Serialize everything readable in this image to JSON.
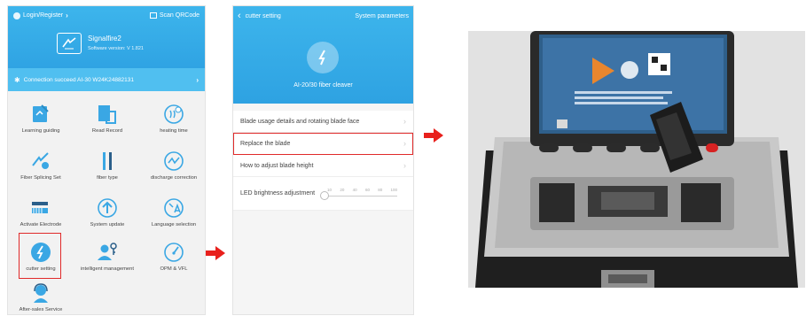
{
  "phone1": {
    "login_label": "Login/Register",
    "scan_label": "Scan QRCode",
    "device_name": "Signalfire2",
    "software_version": "Software version: V 1.821",
    "connection_text": "Connection succeed AI-30 W24K24882131",
    "menu": [
      {
        "label": "Learning guiding",
        "icon": "book-edit-icon"
      },
      {
        "label": "Read Record",
        "icon": "document-icon"
      },
      {
        "label": "heating time",
        "icon": "heat-clock-icon"
      },
      {
        "label": "Fiber Splicing Set",
        "icon": "splice-settings-icon"
      },
      {
        "label": "fiber type",
        "icon": "fiber-type-icon"
      },
      {
        "label": "discharge correction",
        "icon": "discharge-icon"
      },
      {
        "label": "Activate Electrode",
        "icon": "electrode-icon"
      },
      {
        "label": "System update",
        "icon": "upload-icon"
      },
      {
        "label": "Language selection",
        "icon": "language-icon"
      },
      {
        "label": "cutter setting",
        "icon": "cutter-icon"
      },
      {
        "label": "intelligent management",
        "icon": "user-key-icon"
      },
      {
        "label": "OPM & VFL",
        "icon": "gauge-icon"
      },
      {
        "label": "After-sales Service",
        "icon": "support-agent-icon"
      }
    ]
  },
  "phone2": {
    "back_label": "cutter setting",
    "system_parameters_label": "System parameters",
    "device_title": "AI-20/30 fiber cleaver",
    "items": [
      {
        "label": "Blade usage details and rotating blade face"
      },
      {
        "label": "Replace the blade"
      },
      {
        "label": "How to adjust blade height"
      }
    ],
    "slider_label": "LED brightness adjustment",
    "slider_ticks": [
      "10",
      "20",
      "40",
      "60",
      "80",
      "100"
    ],
    "slider_value": 10
  },
  "colors": {
    "header_blue": "#2fa3e3",
    "highlight_red": "#e02a2a",
    "arrow_red": "#e8201c",
    "icon_blue": "#3aa7e4"
  }
}
